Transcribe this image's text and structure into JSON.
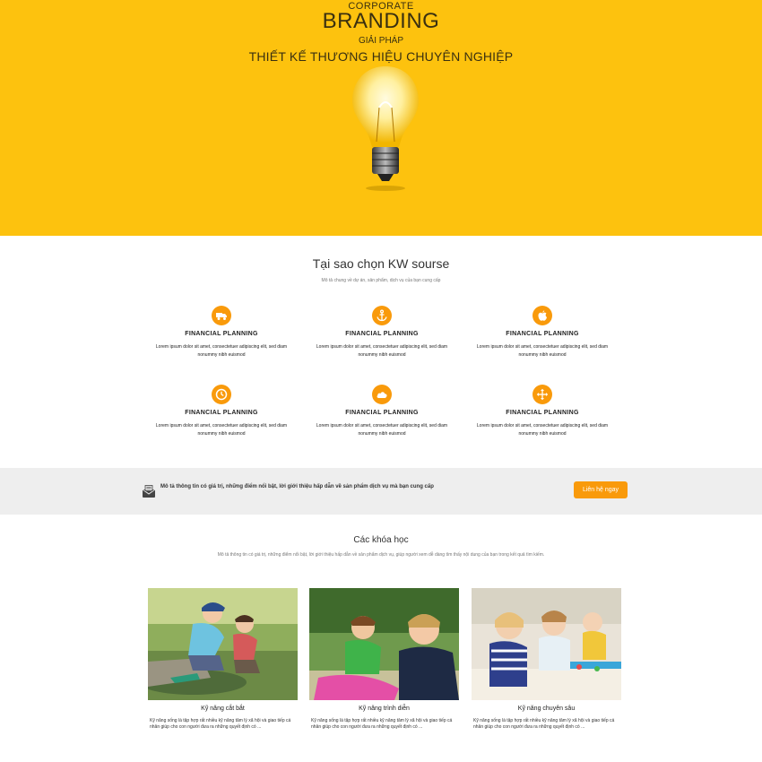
{
  "hero": {
    "line1": "CORPORATE",
    "line2": "BRANDING",
    "line3": "GIẢI PHÁP",
    "line4": "THIẾT KẾ THƯƠNG HIỆU CHUYÊN NGHIỆP",
    "background": "#fdc20e"
  },
  "why": {
    "title": "Tại sao chọn KW sourse",
    "subtitle": "Mô tả chung về dự án, sản phẩm, dịch vụ của bạn cung cấp",
    "features": [
      {
        "icon": "truck-icon",
        "title": "FINANCIAL PLANNING",
        "desc": "Lorem ipsum dolor sit amet, consectetuer adipiscing elit, sed diam nonummy nibh euismod"
      },
      {
        "icon": "anchor-icon",
        "title": "FINANCIAL PLANNING",
        "desc": "Lorem ipsum dolor sit amet, consectetuer adipiscing elit, sed diam nonummy nibh euismod"
      },
      {
        "icon": "apple-icon",
        "title": "FINANCIAL PLANNING",
        "desc": "Lorem ipsum dolor sit amet, consectetuer adipiscing elit, sed diam nonummy nibh euismod"
      },
      {
        "icon": "clock-icon",
        "title": "FINANCIAL PLANNING",
        "desc": "Lorem ipsum dolor sit amet, consectetuer adipiscing elit, sed diam nonummy nibh euismod"
      },
      {
        "icon": "cloud-icon",
        "title": "FINANCIAL PLANNING",
        "desc": "Lorem ipsum dolor sit amet, consectetuer adipiscing elit, sed diam nonummy nibh euismod"
      },
      {
        "icon": "move-arrows-icon",
        "title": "FINANCIAL PLANNING",
        "desc": "Lorem ipsum dolor sit amet, consectetuer adipiscing elit, sed diam nonummy nibh euismod"
      }
    ],
    "accent": "#f99a0b"
  },
  "banner": {
    "icon": "mail-envelope-icon",
    "text": "Mô tả thông tin có giá trị, những điểm nổi bật, lời giới thiệu hấp dẫn về sản phẩm dịch vụ mà bạn cung cấp",
    "button_label": "Liên hệ ngay"
  },
  "courses": {
    "title": "Các khóa học",
    "subtitle": "Mô tả thông tin có giá trị, những điểm nổi bật, lời giới thiệu hấp dẫn về sản phẩm dịch vụ, giúp người xem dễ dàng tìm thấy nội dung của bạn trong kết quả tìm kiếm.",
    "items": [
      {
        "title": "Kỹ năng cắt bắt",
        "desc": "Kỹ năng sống là tập hợp rất nhiều kỹ năng tâm lý xã hội và giao tiếp cá nhân giúp cho con người đưa ra những quyết định có ..."
      },
      {
        "title": "Kỹ năng trình diễn",
        "desc": "Kỹ năng sống là tập hợp rất nhiều kỹ năng tâm lý xã hội và giao tiếp cá nhân giúp cho con người đưa ra những quyết định có ..."
      },
      {
        "title": "Kỹ năng chuyên sâu",
        "desc": "Kỹ năng sống là tập hợp rất nhiều kỹ năng tâm lý xã hội và giao tiếp cá nhân giúp cho con người đưa ra những quyết định có ..."
      }
    ]
  }
}
